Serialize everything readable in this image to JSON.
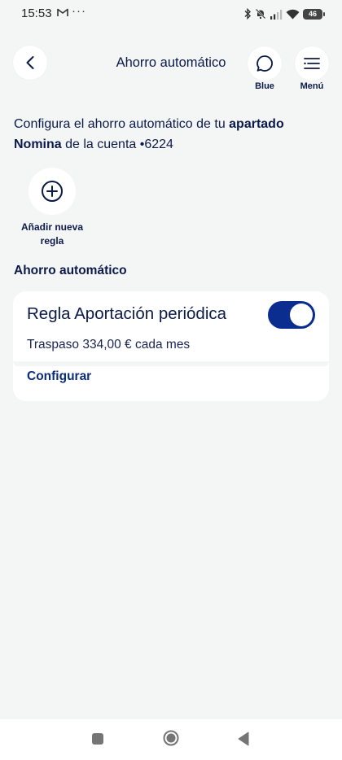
{
  "status_bar": {
    "time": "15:53",
    "mail_icon": "gmail-icon",
    "dots": "···",
    "battery": "46"
  },
  "header": {
    "title": "Ahorro automático",
    "blue_label": "Blue",
    "menu_label": "Menú"
  },
  "intro": {
    "part1": "Configura el ahorro automático de tu ",
    "bold1": "apartado Nomina",
    "part2": " de la cuenta •6224"
  },
  "add_rule": {
    "label_line1": "Añadir nueva",
    "label_line2": "regla"
  },
  "section": {
    "title": "Ahorro automático"
  },
  "rule_card": {
    "title": "Regla Aportación periódica",
    "description": "Traspaso 334,00 € cada mes",
    "configure_label": "Configurar",
    "toggle_on": true
  },
  "colors": {
    "primary": "#0a2d8f",
    "text": "#0c1a4a",
    "background": "#f4f6f6",
    "surface": "#ffffff"
  }
}
